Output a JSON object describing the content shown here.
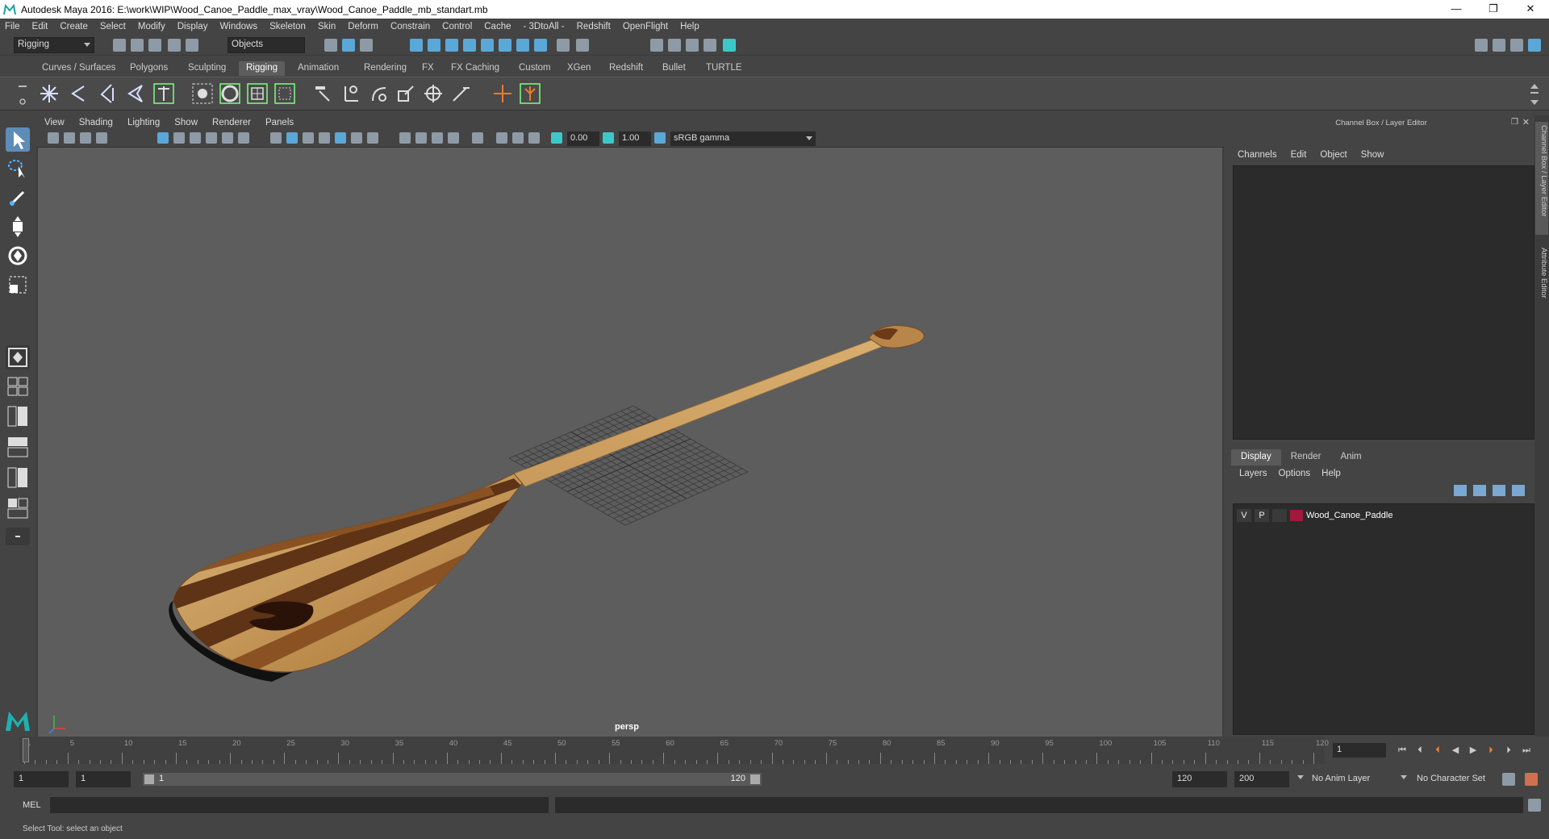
{
  "window": {
    "title": "Autodesk Maya 2016: E:\\work\\WIP\\Wood_Canoe_Paddle_max_vray\\Wood_Canoe_Paddle_mb_standart.mb",
    "minimize": "—",
    "maximize": "❐",
    "close": "✕"
  },
  "menubar": [
    "File",
    "Edit",
    "Create",
    "Select",
    "Modify",
    "Display",
    "Windows",
    "Skeleton",
    "Skin",
    "Deform",
    "Constrain",
    "Control",
    "Cache",
    "- 3DtoAll -",
    "Redshift",
    "OpenFlight",
    "Help"
  ],
  "statusline": {
    "mode": "Rigging",
    "selection_mask": "Objects"
  },
  "shelf_tabs": [
    "Curves / Surfaces",
    "Polygons",
    "Sculpting",
    "Rigging",
    "Animation",
    "Rendering",
    "FX",
    "FX Caching",
    "Custom",
    "XGen",
    "Redshift",
    "Bullet",
    "TURTLE"
  ],
  "active_shelf": "Rigging",
  "viewport": {
    "menu": [
      "View",
      "Shading",
      "Lighting",
      "Show",
      "Renderer",
      "Panels"
    ],
    "exposure": "0.00",
    "gamma": "1.00",
    "color_space": "sRGB gamma",
    "camera_label": "persp"
  },
  "right_panel": {
    "title": "Channel Box / Layer Editor",
    "menu": [
      "Channels",
      "Edit",
      "Object",
      "Show"
    ],
    "layer_tabs": [
      "Display",
      "Render",
      "Anim"
    ],
    "active_layer_tab": "Display",
    "layer_menu": [
      "Layers",
      "Options",
      "Help"
    ],
    "layers": [
      {
        "visible": "V",
        "playback": "P",
        "color": "#a0183a",
        "name": "Wood_Canoe_Paddle"
      }
    ]
  },
  "side_tabs": [
    "Channel Box / Layer Editor",
    "Attribute Editor"
  ],
  "timeline": {
    "ticks": [
      1,
      5,
      10,
      15,
      20,
      25,
      30,
      35,
      40,
      45,
      50,
      55,
      60,
      65,
      70,
      75,
      80,
      85,
      90,
      95,
      100,
      105,
      110,
      115,
      120
    ],
    "current_frame": "1"
  },
  "range": {
    "start": "1",
    "playback_start": "1",
    "slider_start_label": "1",
    "slider_end_label": "120",
    "playback_end": "120",
    "end": "200",
    "anim_layer": "No Anim Layer",
    "character_set": "No Character Set"
  },
  "command_line": {
    "label": "MEL"
  },
  "status_text": "Select Tool: select an object"
}
